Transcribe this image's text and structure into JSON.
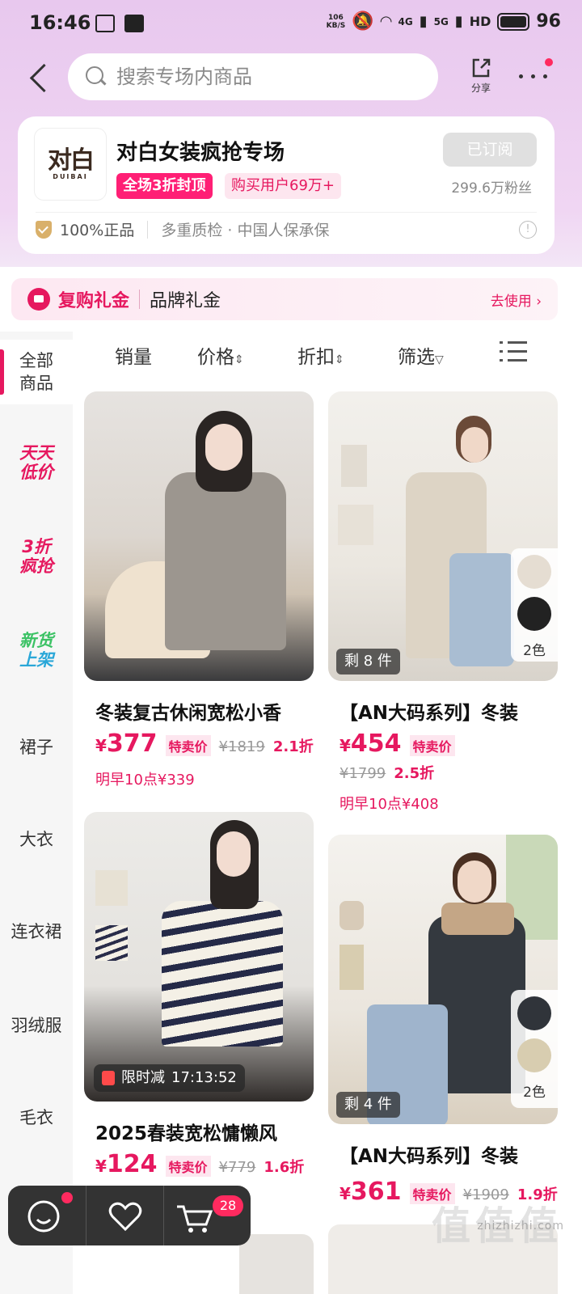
{
  "status": {
    "time": "16:46",
    "net_speed_value": "106",
    "net_speed_unit": "KB/S",
    "signal1": "4G",
    "signal2": "5G",
    "hd": "HD",
    "battery": "96"
  },
  "nav": {
    "search_placeholder": "搜索专场内商品",
    "share_label": "分享"
  },
  "shop": {
    "logo_text": "对白",
    "logo_sub": "DUIBAI",
    "name": "对白女装疯抢专场",
    "sale_tag": "全场3折封顶",
    "buyers_tag": "购买用户69万+",
    "subscribe_label": "已订阅",
    "fans": "299.6万粉丝",
    "assure_main": "100%正品",
    "assure_extra": "多重质检 · 中国人保承保"
  },
  "coupon": {
    "title": "复购礼金",
    "subtitle": "品牌礼金",
    "action": "去使用 ›"
  },
  "sidebar": {
    "items": [
      {
        "label_line1": "全部",
        "label_line2": "商品"
      },
      {
        "label_line1": "天天",
        "label_line2": "低价"
      },
      {
        "label_line1": "3折",
        "label_line2": "疯抢"
      },
      {
        "label_line1": "新货",
        "label_line2": "上架"
      },
      {
        "label": "裙子"
      },
      {
        "label": "大衣"
      },
      {
        "label": "连衣裙"
      },
      {
        "label": "羽绒服"
      },
      {
        "label": "毛衣"
      }
    ]
  },
  "sorts": {
    "sales": "销量",
    "price": "价格",
    "discount": "折扣",
    "filter": "筛选"
  },
  "products": [
    {
      "title": "冬装复古休闲宽松小香",
      "yen": "¥",
      "price": "377",
      "tag": "特卖价",
      "orig": "¥1819",
      "discount": "2.1折",
      "tomorrow": "明早10点¥339"
    },
    {
      "title": "【AN大码系列】冬装",
      "yen": "¥",
      "price": "454",
      "tag": "特卖价",
      "orig": "¥1799",
      "discount": "2.5折",
      "tomorrow": "明早10点¥408",
      "stock": "剩 8 件",
      "colors": "2色"
    },
    {
      "title": "2025春装宽松慵懒风",
      "yen": "¥",
      "price": "124",
      "tag": "特卖价",
      "orig": "¥779",
      "discount": "1.6折",
      "countdown_label": "限时减",
      "countdown_time": "17:13:52"
    },
    {
      "title": "【AN大码系列】冬装",
      "yen": "¥",
      "price": "361",
      "tag": "特卖价",
      "orig": "¥1909",
      "discount": "1.9折",
      "stock": "剩 4 件",
      "colors": "2色"
    }
  ],
  "bottom": {
    "cart_count": "28"
  },
  "watermark": {
    "logo": "值值值",
    "domain": "zhizhizhi.com"
  }
}
